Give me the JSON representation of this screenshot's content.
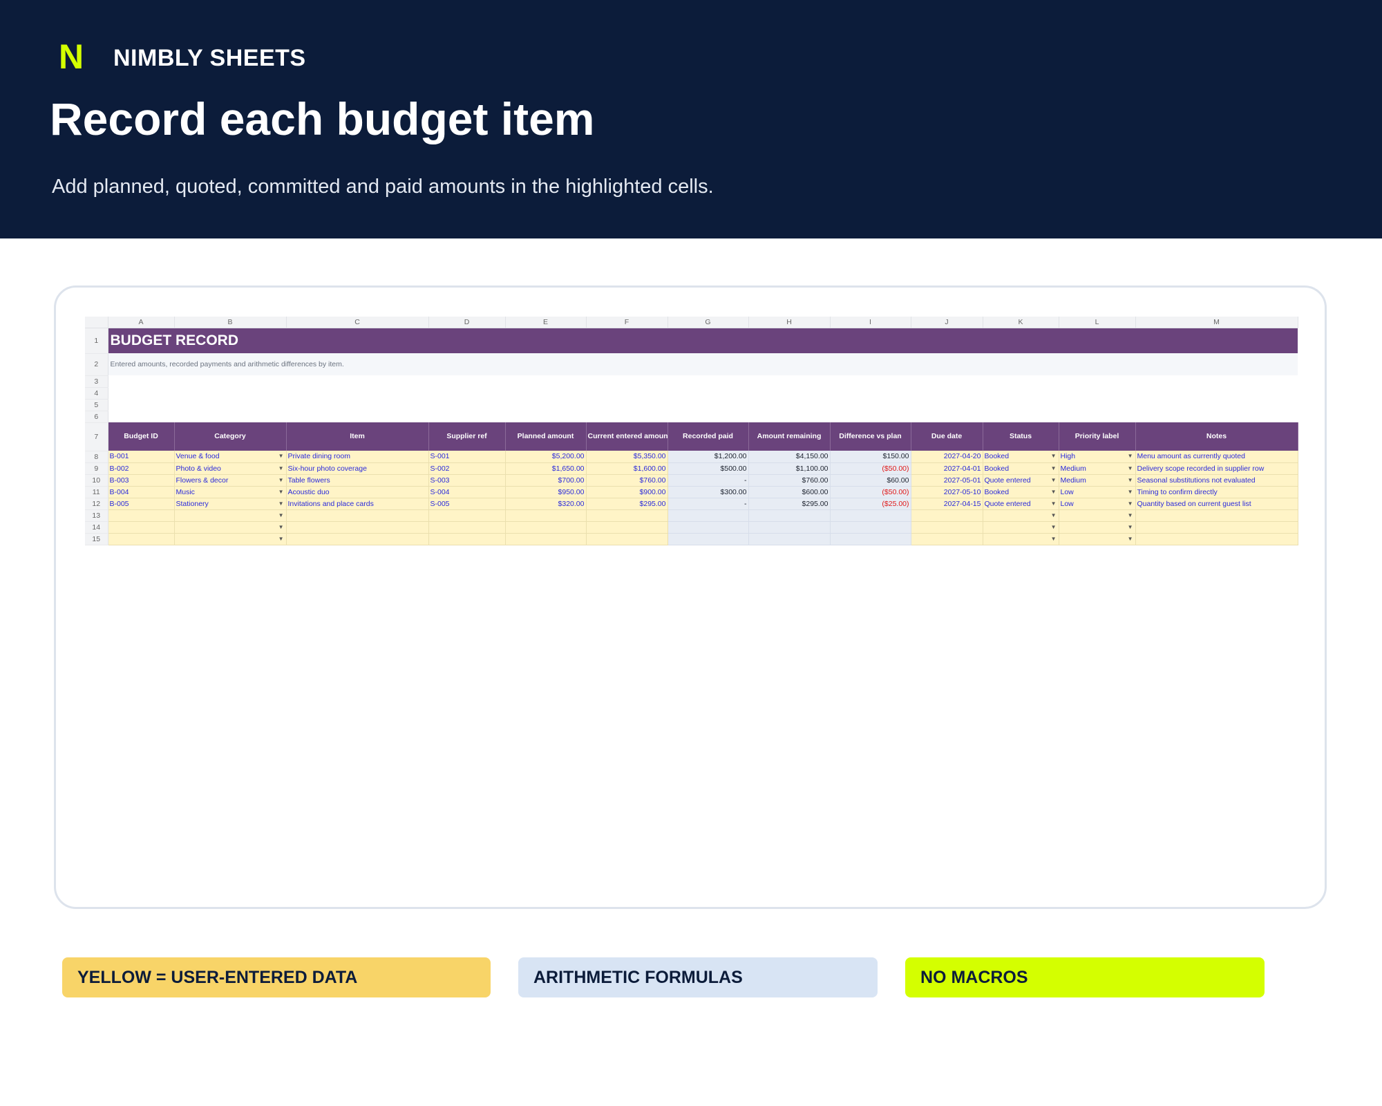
{
  "brand": {
    "logo": "N",
    "name": "NIMBLY SHEETS"
  },
  "page": {
    "title": "Record each budget item",
    "subtitle": "Add planned, quoted, committed and paid amounts in the highlighted cells."
  },
  "sheet": {
    "columns": [
      "A",
      "B",
      "C",
      "D",
      "E",
      "F",
      "G",
      "H",
      "I",
      "J",
      "K",
      "L",
      "M"
    ],
    "row_numbers": [
      "1",
      "2",
      "3",
      "4",
      "5",
      "6",
      "7",
      "8",
      "9",
      "10",
      "11",
      "12",
      "13",
      "14",
      "15"
    ],
    "title": "BUDGET RECORD",
    "description": "Entered amounts, recorded payments and arithmetic differences by item.",
    "headers": [
      "Budget ID",
      "Category",
      "Item",
      "Supplier ref",
      "Planned amount",
      "Current entered amount",
      "Recorded paid",
      "Amount remaining",
      "Difference vs plan",
      "Due date",
      "Status",
      "Priority label",
      "Notes"
    ],
    "rows": [
      [
        "B-001",
        "Venue & food",
        "Private dining room",
        "S-001",
        "$5,200.00",
        "$5,350.00",
        "$1,200.00",
        "$4,150.00",
        "$150.00",
        "2027-04-20",
        "Booked",
        "High",
        "Menu amount as currently quoted"
      ],
      [
        "B-002",
        "Photo & video",
        "Six-hour photo coverage",
        "S-002",
        "$1,650.00",
        "$1,600.00",
        "$500.00",
        "$1,100.00",
        "($50.00)",
        "2027-04-01",
        "Booked",
        "Medium",
        "Delivery scope recorded in supplier row"
      ],
      [
        "B-003",
        "Flowers & decor",
        "Table flowers",
        "S-003",
        "$700.00",
        "$760.00",
        "-",
        "$760.00",
        "$60.00",
        "2027-05-01",
        "Quote entered",
        "Medium",
        "Seasonal substitutions not evaluated"
      ],
      [
        "B-004",
        "Music",
        "Acoustic duo",
        "S-004",
        "$950.00",
        "$900.00",
        "$300.00",
        "$600.00",
        "($50.00)",
        "2027-05-10",
        "Booked",
        "Low",
        "Timing to confirm directly"
      ],
      [
        "B-005",
        "Stationery",
        "Invitations and place cards",
        "S-005",
        "$320.00",
        "$295.00",
        "-",
        "$295.00",
        "($25.00)",
        "2027-04-15",
        "Quote entered",
        "Low",
        "Quantity based on current guest list"
      ],
      [
        "",
        "",
        "",
        "",
        "",
        "",
        "",
        "",
        "",
        "",
        "",
        "",
        ""
      ],
      [
        "",
        "",
        "",
        "",
        "",
        "",
        "",
        "",
        "",
        "",
        "",
        "",
        ""
      ],
      [
        "",
        "",
        "",
        "",
        "",
        "",
        "",
        "",
        "",
        "",
        "",
        "",
        ""
      ]
    ],
    "negative_color": "#e01a1a",
    "header_color": "#6a437c",
    "input_fill": "#fff4c7",
    "formula_fill": "#e7ecf4"
  },
  "legend": {
    "user_data": "YELLOW = USER-ENTERED DATA",
    "formulas": "ARITHMETIC FORMULAS",
    "macros": "NO MACROS"
  }
}
